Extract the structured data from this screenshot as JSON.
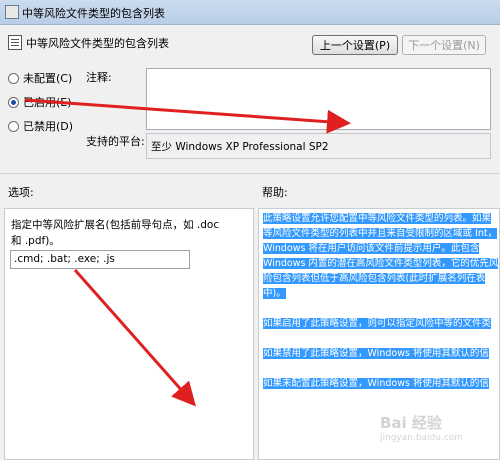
{
  "window": {
    "title": "中等风险文件类型的包含列表"
  },
  "header": {
    "title": "中等风险文件类型的包含列表"
  },
  "nav": {
    "prev_label": "上一个设置(P)",
    "next_label": "下一个设置(N)"
  },
  "state": {
    "options": [
      {
        "label": "未配置(C)",
        "selected": false
      },
      {
        "label": "已启用(E)",
        "selected": true
      },
      {
        "label": "已禁用(D)",
        "selected": false
      }
    ]
  },
  "comment": {
    "label": "注释:",
    "value": ""
  },
  "platform": {
    "label": "支持的平台:",
    "value": "至少 Windows XP Professional SP2"
  },
  "options_section": {
    "label": "选项:",
    "description_line1": "指定中等风险扩展名(包括前导句点，如 .doc",
    "description_line2": "和 .pdf)。",
    "extensions_value": ".cmd; .bat; .exe; .js"
  },
  "help_section": {
    "label": "帮助:",
    "paragraphs": [
      "此策略设置允许您配置中等风险文件类型的列表。如果等风险文件类型的列表中并且来自受限制的区域或 Int，Windows 将在用户访问该文件前提示用户。此包含Windows 内置的潜在高风险文件类型列表，它的优先风险包含列表但低于高风险包含列表(此时扩展名列在表中)。",
      "如果启用了此策略设置，则可以指定风险中等的文件类",
      "如果禁用了此策略设置，Windows 将使用其默认的信",
      "如果未配置此策略设置，Windows 将使用其默认的信"
    ]
  },
  "watermark": {
    "logo": "Bai 经验",
    "sub": "jingyan.baidu.com"
  },
  "colors": {
    "arrow": "#e02020",
    "selection": "#3399ff",
    "titlebar": "#c6d8ee"
  }
}
